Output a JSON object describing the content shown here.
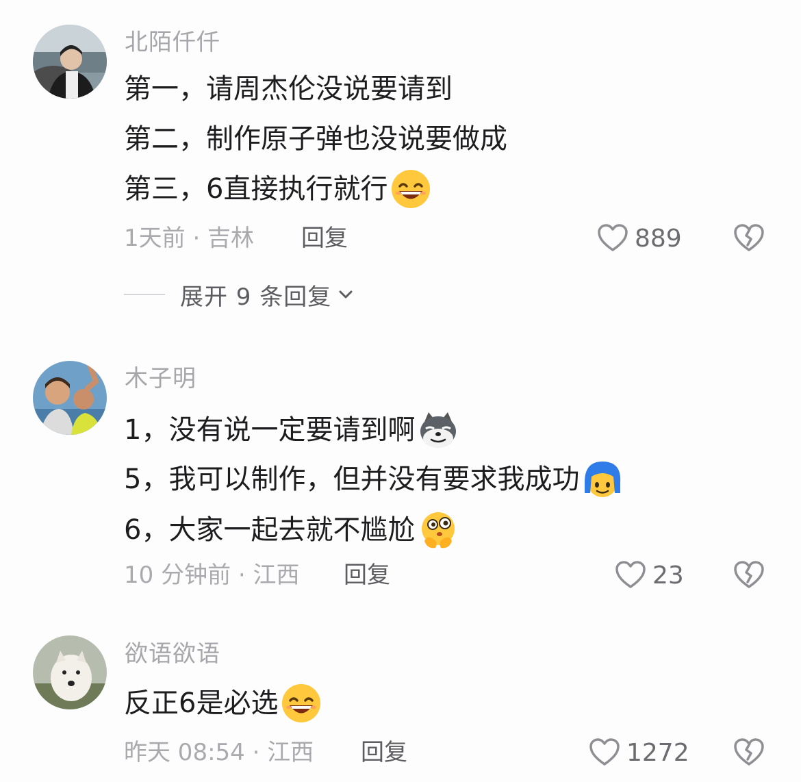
{
  "comments": [
    {
      "username": "北陌仟仟",
      "lines": [
        "第一，请周杰伦没说要请到",
        "第二，制作原子弹也没说要做成",
        "第三，6直接执行就行"
      ],
      "time_location": "1天前 · 吉林",
      "reply_label": "回复",
      "likes": "889",
      "expand_label": "展开 9 条回复",
      "emojis": [
        "grin-emoji"
      ]
    },
    {
      "username": "木子明",
      "lines": [
        "1，没有说一定要请到啊",
        "5，我可以制作，但并没有要求我成功",
        "6，大家一起去就不尴尬"
      ],
      "time_location": "10 分钟前 · 江西",
      "reply_label": "回复",
      "likes": "23",
      "emojis": [
        "wolf-emoji",
        "blue-hair-emoji",
        "thinking-emoji"
      ]
    },
    {
      "username": "欲语欲语",
      "lines": [
        "反正6是必选"
      ],
      "time_location": "昨天 08:54 · 江西",
      "reply_label": "回复",
      "likes": "1272",
      "emojis": [
        "grin-emoji"
      ]
    }
  ],
  "colors": {
    "username": "#a6a6ab",
    "text": "#1d1d1f",
    "meta": "#a9a9ae",
    "emoji_yellow": "#ffc83d"
  }
}
